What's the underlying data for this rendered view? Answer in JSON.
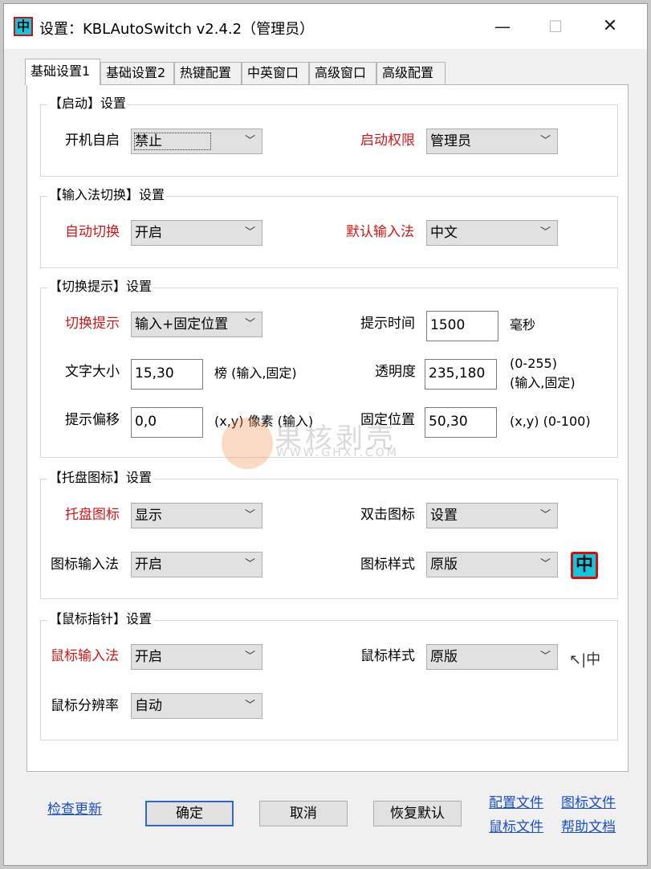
{
  "window": {
    "title": "设置：KBLAutoSwitch v2.4.2（管理员）",
    "app_icon": "中",
    "min_glyph": "—",
    "max_glyph": "☐",
    "close_glyph": "✕"
  },
  "tabs": [
    "基础设置1",
    "基础设置2",
    "热键配置",
    "中英窗口",
    "高级窗口",
    "高级配置"
  ],
  "startup": {
    "title": "【启动】设置",
    "autostart_label": "开机自启",
    "autostart_value": "禁止",
    "permission_label": "启动权限",
    "permission_value": "管理员"
  },
  "ime_switch": {
    "title": "【输入法切换】设置",
    "auto_label": "自动切换",
    "auto_value": "开启",
    "default_label": "默认输入法",
    "default_value": "中文"
  },
  "hint": {
    "title": "【切换提示】设置",
    "hint_label": "切换提示",
    "hint_value": "输入+固定位置",
    "time_label": "提示时间",
    "time_value": "1500",
    "time_unit": "毫秒",
    "font_label": "文字大小",
    "font_value": "15,30",
    "font_note": "榜 (输入,固定)",
    "alpha_label": "透明度",
    "alpha_value": "235,180",
    "alpha_note1": "(0-255)",
    "alpha_note2": "(输入,固定)",
    "offset_label": "提示偏移",
    "offset_value": "0,0",
    "offset_note": "(x,y) 像素 (输入)",
    "pos_label": "固定位置",
    "pos_value": "50,30",
    "pos_note": "(x,y) (0-100)"
  },
  "tray": {
    "title": "【托盘图标】设置",
    "tray_label": "托盘图标",
    "tray_value": "显示",
    "dbl_label": "双击图标",
    "dbl_value": "设置",
    "ime_label": "图标输入法",
    "ime_value": "开启",
    "style_label": "图标样式",
    "style_value": "原版",
    "preview": "中"
  },
  "mouse": {
    "title": "【鼠标指针】设置",
    "ime_label": "鼠标输入法",
    "ime_value": "开启",
    "style_label": "鼠标样式",
    "style_value": "原版",
    "res_label": "鼠标分辨率",
    "res_value": "自动",
    "cursor_preview": "↖|中"
  },
  "watermark": {
    "main": "果核剥壳",
    "sub": "WWW.GHXI.COM"
  },
  "footer": {
    "check_update": "检查更新",
    "ok": "确定",
    "cancel": "取消",
    "restore": "恢复默认",
    "config_file": "配置文件",
    "icon_file": "图标文件",
    "mouse_file": "鼠标文件",
    "help_doc": "帮助文档"
  },
  "colors": {
    "label_red": "#d01818",
    "link_blue": "#1a4fc4",
    "focus_border": "#2a6ad8"
  }
}
